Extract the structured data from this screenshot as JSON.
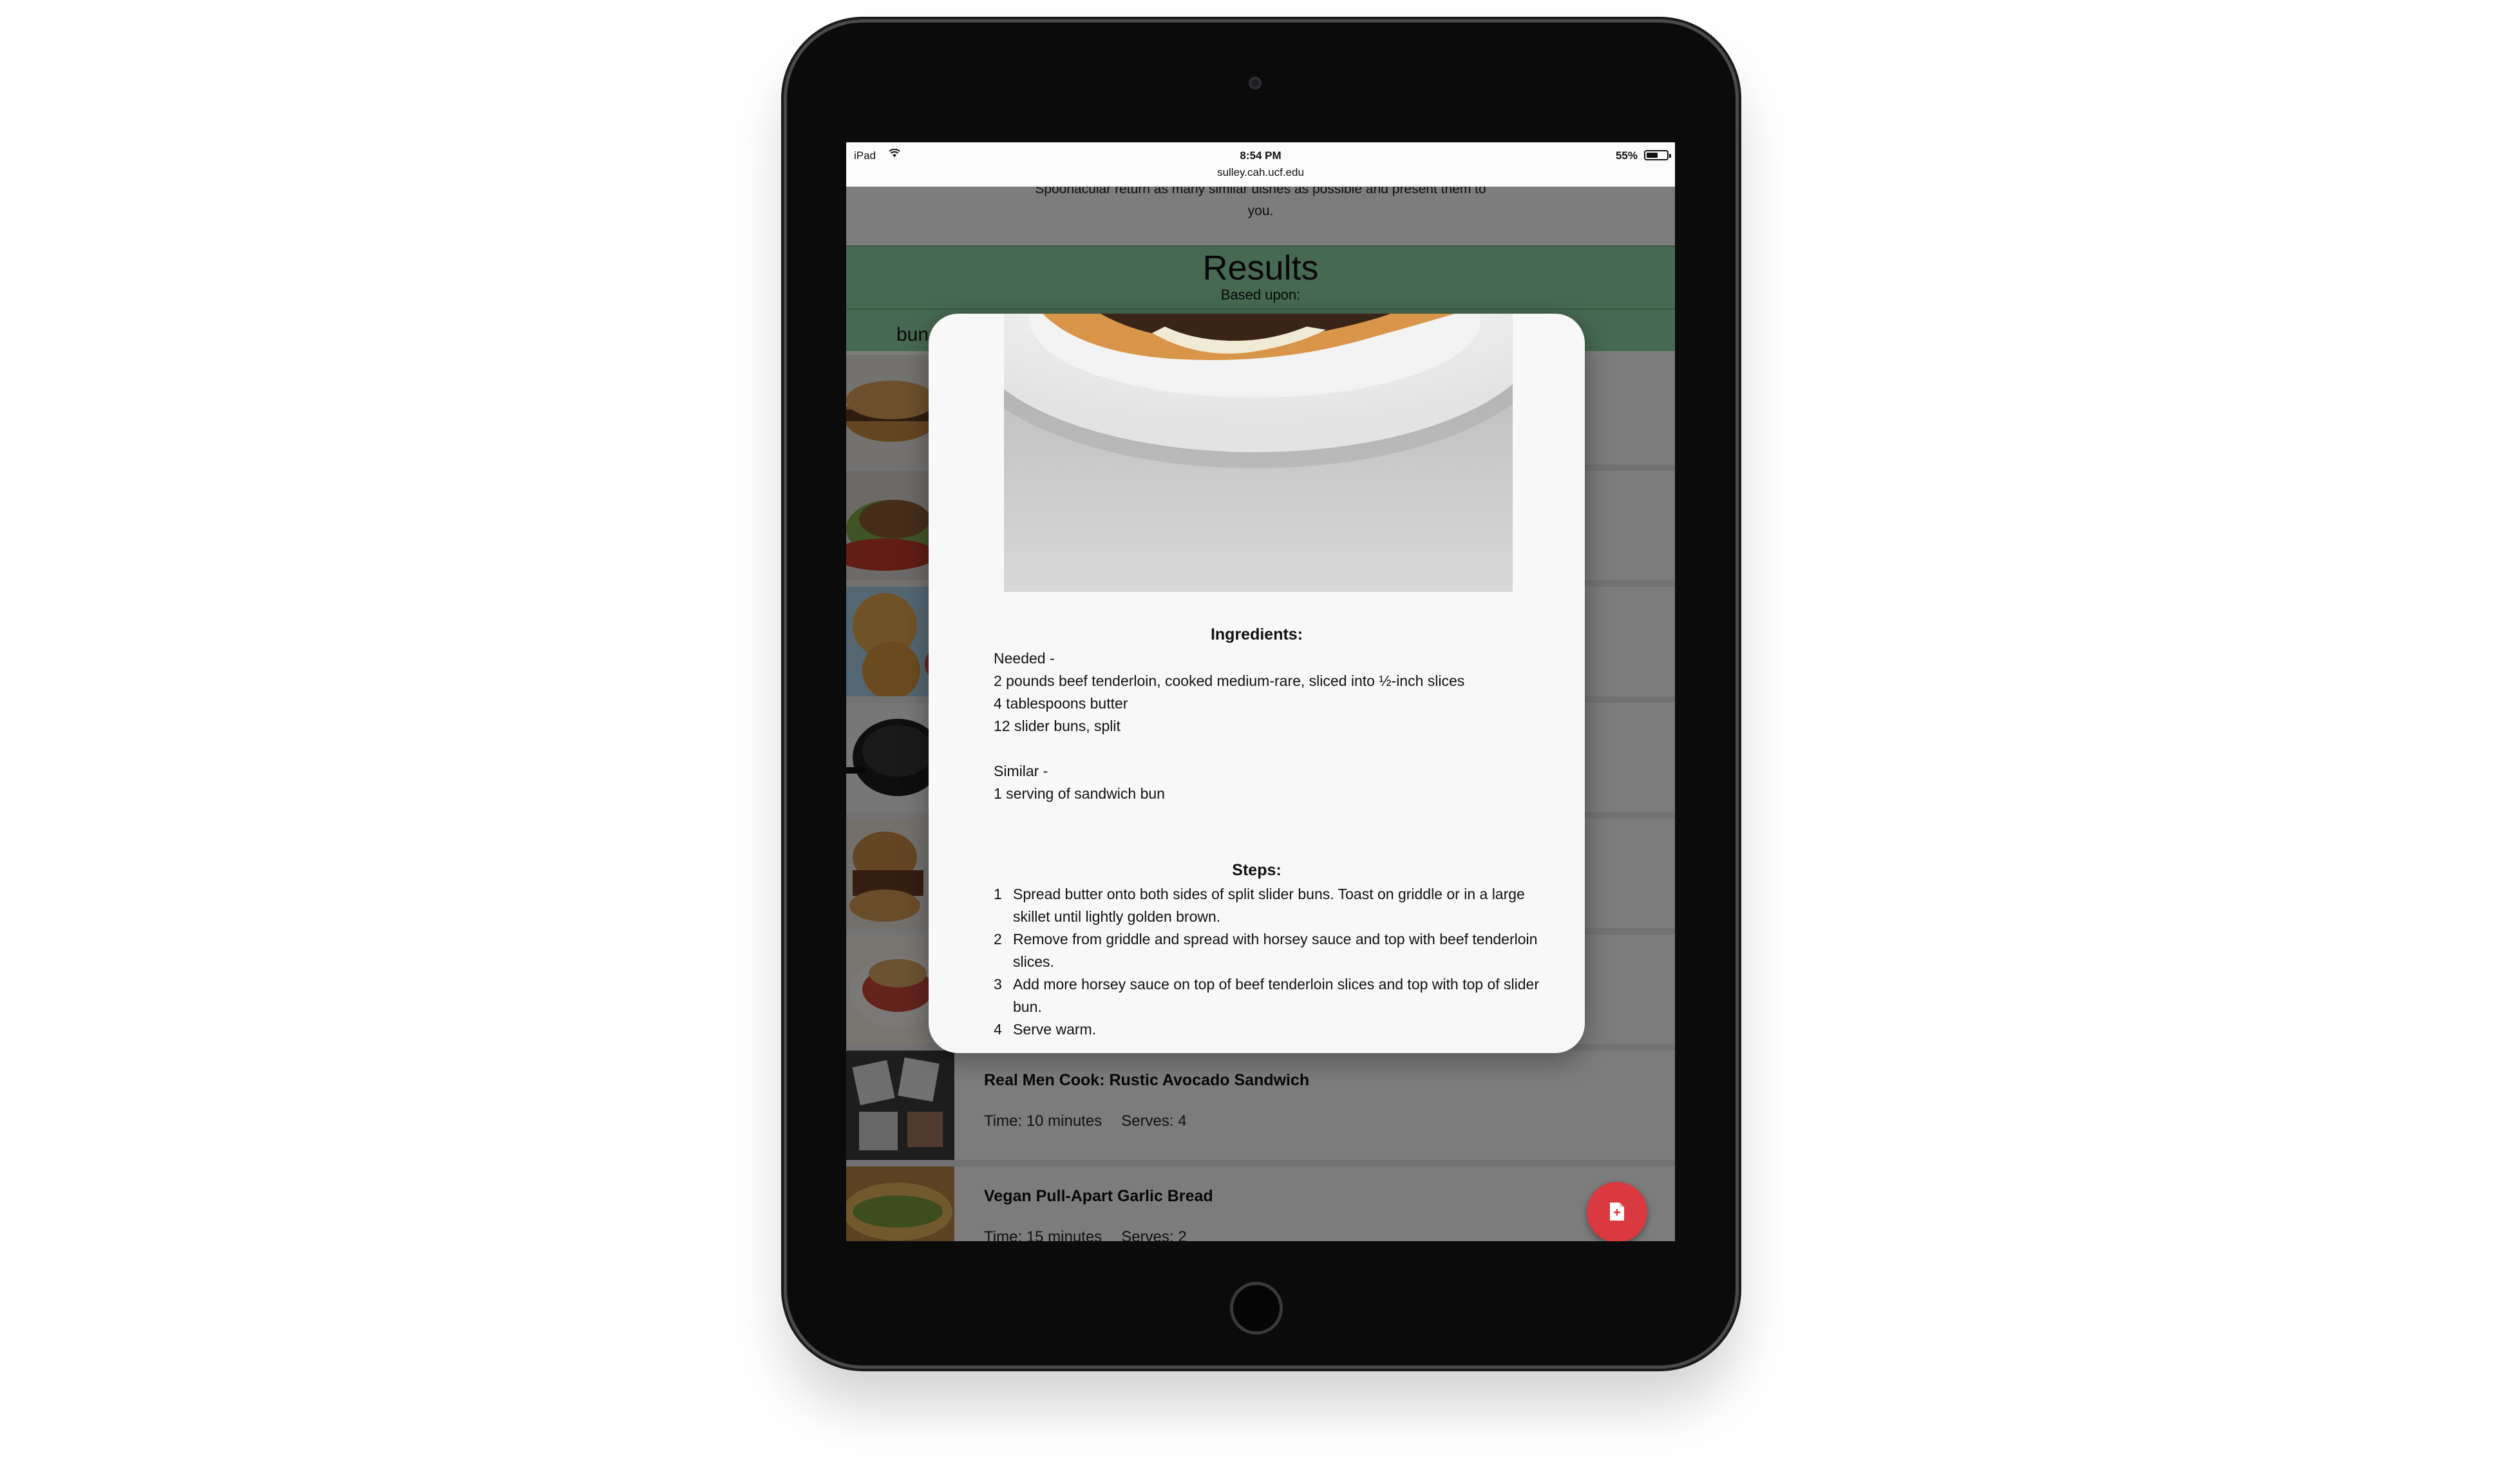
{
  "status_bar": {
    "device": "iPad",
    "time": "8:54 PM",
    "url": "sulley.cah.ucf.edu",
    "battery": "55%"
  },
  "page": {
    "intro_text_line1": "Spoonacular return as many similar dishes as possible and present them to",
    "intro_text_line2": "you.",
    "results_title": "Results",
    "based_upon": "Based upon:",
    "chip": "bun",
    "results": [
      {
        "title": "",
        "time": "",
        "serves": ""
      },
      {
        "title": "",
        "time": "",
        "serves": ""
      },
      {
        "title": "",
        "time": "",
        "serves": ""
      },
      {
        "title": "",
        "time": "",
        "serves": ""
      },
      {
        "title": "",
        "time": "",
        "serves": ""
      },
      {
        "title": "",
        "time": "",
        "serves": ""
      },
      {
        "title": "Real Men Cook: Rustic Avocado Sandwich",
        "time": "Time: 10 minutes",
        "serves": "Serves: 4"
      },
      {
        "title": "Vegan Pull-Apart Garlic Bread",
        "time": "Time: 15 minutes",
        "serves": "Serves: 2"
      }
    ]
  },
  "modal": {
    "ingredients_heading": "Ingredients:",
    "needed_label": "Needed -",
    "needed": [
      "2 pounds beef tenderloin, cooked medium-rare, sliced into ½-inch slices",
      "4 tablespoons butter",
      "12 slider buns, split"
    ],
    "similar_label": "Similar -",
    "similar": [
      "1 serving of sandwich bun"
    ],
    "steps_heading": "Steps:",
    "steps": [
      {
        "num": "1",
        "text": "Spread butter onto both sides of split slider buns. Toast on griddle or in a large skillet until lightly golden brown."
      },
      {
        "num": "2",
        "text": "Remove from griddle and spread with horsey sauce and top with beef tenderloin slices."
      },
      {
        "num": "3",
        "text": "Add more horsey sauce on top of beef tenderloin slices and top with top of slider bun."
      },
      {
        "num": "4",
        "text": "Serve warm."
      }
    ]
  },
  "colors": {
    "accent_green": "#8fd3a3",
    "fab_red": "#d9393f"
  }
}
